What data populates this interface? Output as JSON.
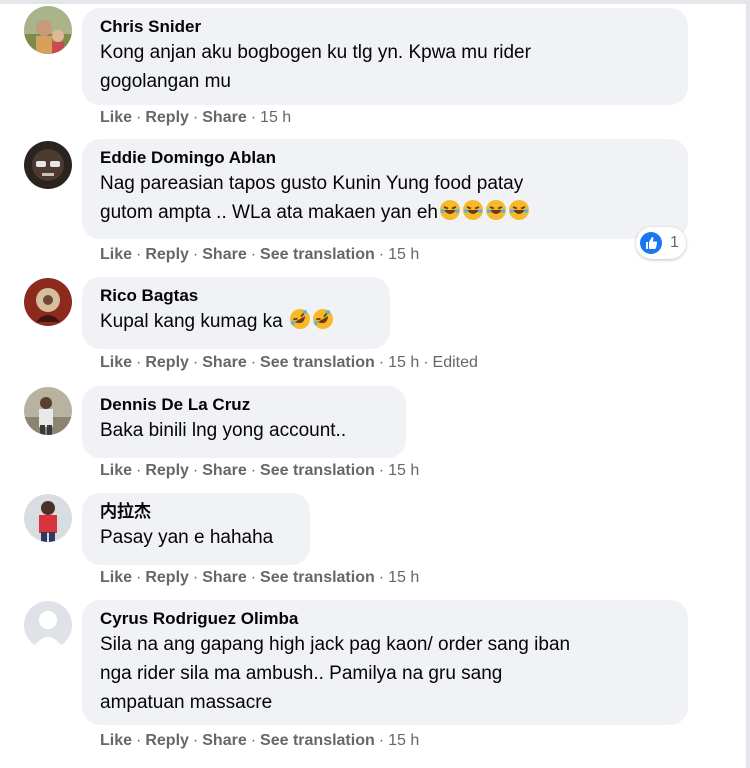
{
  "actions": {
    "like": "Like",
    "reply": "Reply",
    "share": "Share",
    "see_translation": "See translation",
    "dot": "·"
  },
  "colors": {
    "bubble_bg": "#f0f2f5",
    "meta_text": "#65676b",
    "like_blue": "#1877f2"
  },
  "comments": [
    {
      "author": "Chris Snider",
      "lines": [
        "Kong anjan aku bogbogen ku tlg yn. Kpwa mu rider",
        "gogolangan mu"
      ],
      "time": "15 h",
      "avatar_icon": "profile-photo-icon"
    },
    {
      "author": "Eddie Domingo Ablan",
      "lines": [
        "Nag pareasian tapos gusto Kunin Yung food patay",
        "gutom ampta .. WLa ata makaen yan eh"
      ],
      "emojis": "laughing-emoji-icon x4",
      "time": "15 h",
      "reaction_count": "1",
      "reaction_icon": "like-reaction-icon"
    },
    {
      "author": "Rico Bagtas",
      "lines": [
        "Kupal kang kumag ka"
      ],
      "emojis": "rolling-laughing-emoji-icon x2",
      "time": "15 h",
      "edited": "Edited"
    },
    {
      "author": "Dennis De La Cruz",
      "lines": [
        "Baka binili lng yong account.."
      ],
      "time": "15 h"
    },
    {
      "author": "内拉杰",
      "lines": [
        "Pasay yan e hahaha"
      ],
      "time": "15 h"
    },
    {
      "author": "Cyrus Rodriguez Olimba",
      "lines": [
        "Sila na ang gapang high jack pag kaon/ order sang iban",
        "nga rider sila ma ambush.. Pamilya na gru sang",
        "ampatuan massacre"
      ],
      "time": "15 h",
      "avatar_icon": "default-avatar-icon"
    }
  ]
}
